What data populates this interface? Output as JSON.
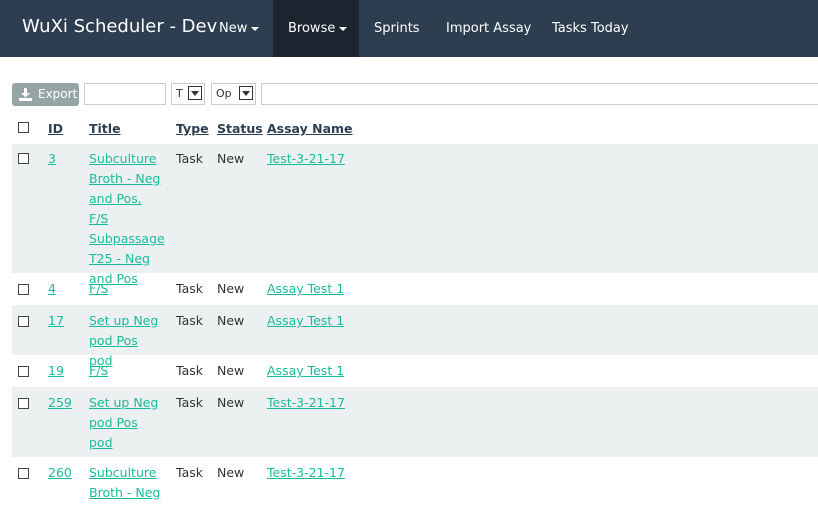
{
  "navbar": {
    "brand": "WuXi Scheduler - Dev",
    "items": [
      {
        "label": "New",
        "dropdown": true,
        "active": false
      },
      {
        "label": "Browse",
        "dropdown": true,
        "active": true
      },
      {
        "label": "Sprints",
        "dropdown": false,
        "active": false
      },
      {
        "label": "Import Assay",
        "dropdown": false,
        "active": false
      },
      {
        "label": "Tasks Today",
        "dropdown": false,
        "active": false
      }
    ]
  },
  "toolbar": {
    "export_label": "Export",
    "search_value": "",
    "type_select": "T",
    "op_select": "Op",
    "filter_value": ""
  },
  "table": {
    "headers": [
      "ID",
      "Title",
      "Type",
      "Status",
      "Assay Name"
    ],
    "rows": [
      {
        "id": "3",
        "title": "Subculture Broth - Neg and Pos, F/S Subpassage T25 - Neg and Pos",
        "type": "Task",
        "status": "New",
        "assay": "Test-3-21-17"
      },
      {
        "id": "4",
        "title": "F/S",
        "type": "Task",
        "status": "New",
        "assay": "Assay Test 1"
      },
      {
        "id": "17",
        "title": "Set up Neg pod Pos pod",
        "type": "Task",
        "status": "New",
        "assay": "Assay Test 1"
      },
      {
        "id": "19",
        "title": "F/S",
        "type": "Task",
        "status": "New",
        "assay": "Assay Test 1"
      },
      {
        "id": "259",
        "title": "Set up Neg pod Pos pod",
        "type": "Task",
        "status": "New",
        "assay": "Test-3-21-17"
      },
      {
        "id": "260",
        "title": "Subculture Broth - Neg",
        "type": "Task",
        "status": "New",
        "assay": "Test-3-21-17"
      }
    ]
  },
  "colors": {
    "navbar": "#2c3e50",
    "navbar_active": "#1a252f",
    "link": "#18bc9c",
    "stripe": "#ecf0f1",
    "export_button": "#95a5a6"
  }
}
